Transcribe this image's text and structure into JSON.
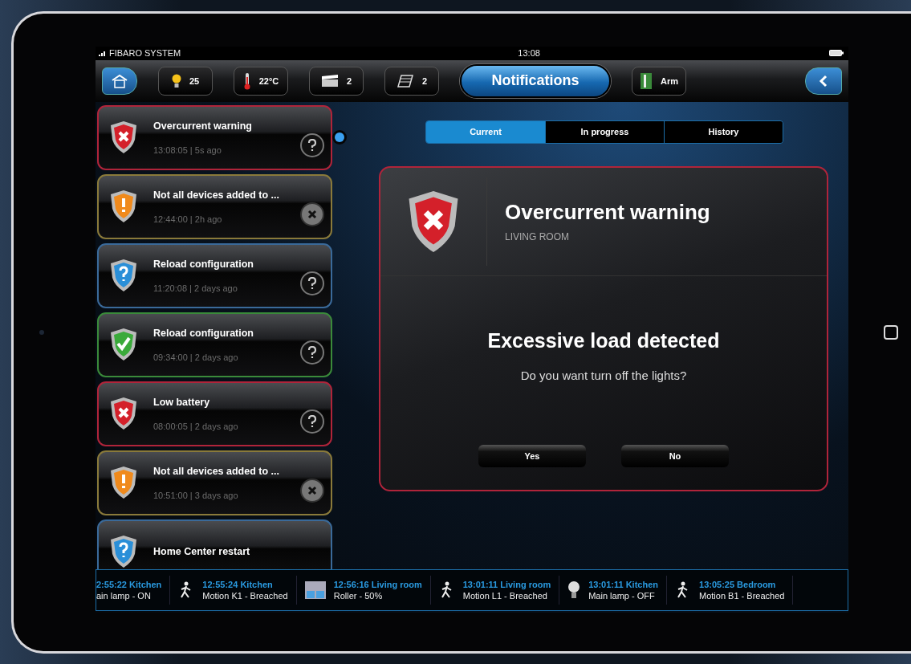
{
  "status_bar": {
    "carrier": "FIBARO SYSTEM",
    "time": "13:08"
  },
  "toolbar": {
    "items": [
      {
        "kind": "light",
        "label": "25",
        "selected": false
      },
      {
        "kind": "thermometer",
        "label": "22°C",
        "selected": false
      },
      {
        "kind": "scene",
        "label": "2",
        "selected": false
      },
      {
        "kind": "blind",
        "label": "2",
        "selected": false
      },
      {
        "kind": "notifications",
        "label": "Notifications",
        "selected": true
      },
      {
        "kind": "alarm",
        "label": "Arm",
        "selected": false
      }
    ]
  },
  "notifications": [
    {
      "kind": "error",
      "title": "Overcurrent warning",
      "meta": "13:08:05 | 5s ago",
      "dismissable": false,
      "selected": true
    },
    {
      "kind": "warning",
      "title": "Not all devices added to ...",
      "meta": "12:44:00 | 2h ago",
      "dismissable": true,
      "selected": false
    },
    {
      "kind": "info",
      "title": "Reload configuration",
      "meta": "11:20:08 | 2 days ago",
      "dismissable": false,
      "selected": false
    },
    {
      "kind": "ok",
      "title": "Reload configuration",
      "meta": "09:34:00 | 2 days ago",
      "dismissable": false,
      "selected": false
    },
    {
      "kind": "error",
      "title": "Low battery",
      "meta": "08:00:05 | 2 days ago",
      "dismissable": false,
      "selected": false
    },
    {
      "kind": "warning",
      "title": "Not all devices added to ...",
      "meta": "10:51:00 | 3 days ago",
      "dismissable": true,
      "selected": false
    },
    {
      "kind": "info",
      "title": "Home Center restart",
      "selected": false
    }
  ],
  "tabs": [
    {
      "label": "Current",
      "selected": true
    },
    {
      "label": "In progress",
      "selected": false
    },
    {
      "label": "History",
      "selected": false
    }
  ],
  "detail": {
    "kind": "error",
    "title": "Overcurrent warning",
    "room": "LIVING ROOM",
    "message": "Excessive load detected",
    "question": "Do you want turn off the lights?",
    "buttons": [
      "Yes",
      "No"
    ]
  },
  "ticker": [
    {
      "kind": "none",
      "event": "2:55:22 Kitchen",
      "state": "ain lamp - ON"
    },
    {
      "kind": "motion",
      "event": "12:55:24 Kitchen",
      "state": "Motion K1 - Breached"
    },
    {
      "kind": "roller",
      "event": "12:56:16 Living room",
      "state": "Roller - 50%"
    },
    {
      "kind": "motion",
      "event": "13:01:11 Living room",
      "state": "Motion L1 - Breached"
    },
    {
      "kind": "lamp",
      "event": "13:01:11 Kitchen",
      "state": "Main lamp - OFF"
    },
    {
      "kind": "motion",
      "event": "13:05:25 Bedroom",
      "state": "Motion B1 - Breached"
    }
  ]
}
